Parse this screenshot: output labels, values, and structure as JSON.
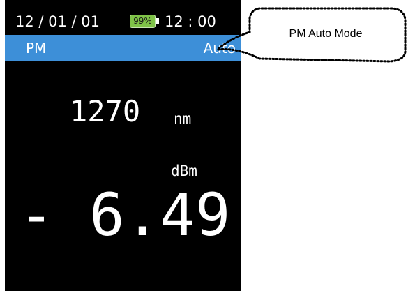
{
  "status": {
    "date": "12 / 01 / 01",
    "battery_level": "99%",
    "time": "12 : 00"
  },
  "mode_bar": {
    "left_label": "PM",
    "right_label": "Auto"
  },
  "readings": {
    "wavelength": "1270",
    "wavelength_unit": "nm",
    "power_unit": "dBm",
    "power": "- 6.49"
  },
  "callout": {
    "text": "PM Auto Mode"
  },
  "colors": {
    "screen_background": "#000000",
    "mode_bar": "#3d8fd8",
    "battery_fill": "#7fc348",
    "text": "#ffffff"
  }
}
